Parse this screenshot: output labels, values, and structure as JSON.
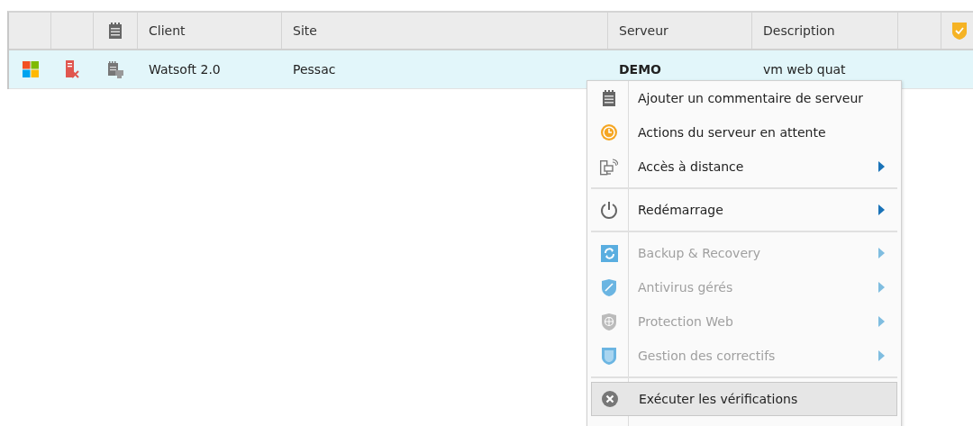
{
  "table": {
    "columns": [
      {
        "kind": "blank"
      },
      {
        "kind": "blank"
      },
      {
        "kind": "icon"
      },
      {
        "kind": "text",
        "label": "Client"
      },
      {
        "kind": "text",
        "label": "Site"
      },
      {
        "kind": "text",
        "label": "Serveur"
      },
      {
        "kind": "text",
        "label": "Description"
      },
      {
        "kind": "blank"
      },
      {
        "kind": "icon"
      }
    ],
    "rows": [
      {
        "selected": true,
        "client": "Watsoft 2.0",
        "site": "Pessac",
        "server": "DEMO",
        "description": "vm web quat"
      }
    ]
  },
  "context_menu": {
    "items": [
      {
        "kind": "item",
        "label": "Ajouter un commentaire de serveur",
        "disabled": false,
        "submenu": false,
        "selected": false
      },
      {
        "kind": "item",
        "label": "Actions du serveur en attente",
        "disabled": false,
        "submenu": false,
        "selected": false
      },
      {
        "kind": "item",
        "label": "Accès à distance",
        "disabled": false,
        "submenu": true,
        "selected": false
      },
      {
        "kind": "separator"
      },
      {
        "kind": "item",
        "label": "Redémarrage",
        "disabled": false,
        "submenu": true,
        "selected": false
      },
      {
        "kind": "separator"
      },
      {
        "kind": "item",
        "label": "Backup & Recovery",
        "disabled": true,
        "submenu": true,
        "selected": false
      },
      {
        "kind": "item",
        "label": "Antivirus gérés",
        "disabled": true,
        "submenu": true,
        "selected": false
      },
      {
        "kind": "item",
        "label": "Protection Web",
        "disabled": true,
        "submenu": true,
        "selected": false
      },
      {
        "kind": "item",
        "label": "Gestion des correctifs",
        "disabled": true,
        "submenu": true,
        "selected": false
      },
      {
        "kind": "separator"
      },
      {
        "kind": "item",
        "label": "Exécuter les vérifications",
        "disabled": false,
        "submenu": false,
        "selected": true
      }
    ]
  }
}
